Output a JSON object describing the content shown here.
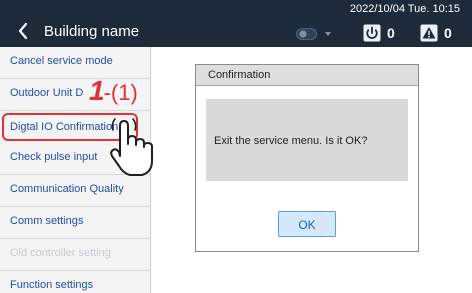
{
  "header": {
    "back_icon": "chevron-left-icon",
    "title": "Building name",
    "datetime": "2022/10/04 Tue. 10:15",
    "power_icon": "power-icon",
    "power_count": "0",
    "alarm_icon": "warning-triangle-icon",
    "alarm_count": "0",
    "toggle_icon": "toggle-dropdown-icon"
  },
  "sidebar": {
    "items": [
      {
        "label": "Cancel service mode",
        "enabled": true
      },
      {
        "label": "Outdoor Unit D",
        "enabled": true
      },
      {
        "label": "Digtal IO Confirmation",
        "enabled": true,
        "highlighted": true
      },
      {
        "label": "Check pulse input",
        "enabled": true
      },
      {
        "label": "Communication Quality",
        "enabled": true
      },
      {
        "label": "Comm settings",
        "enabled": true
      },
      {
        "label": "Old controller setting",
        "enabled": false
      },
      {
        "label": "Function settings",
        "enabled": true
      }
    ]
  },
  "annotation": {
    "step_number": "1",
    "step_sub": "-(1)",
    "color": "#e3303c",
    "hand_icon": "pointing-hand-icon"
  },
  "dialog": {
    "title": "Confirmation",
    "message": "Exit the service menu. Is it OK?",
    "ok_label": "OK"
  },
  "colors": {
    "header_bg": "#1c2a3a",
    "link_blue": "#1e4fa6",
    "ok_bg": "#d4e9fb"
  }
}
